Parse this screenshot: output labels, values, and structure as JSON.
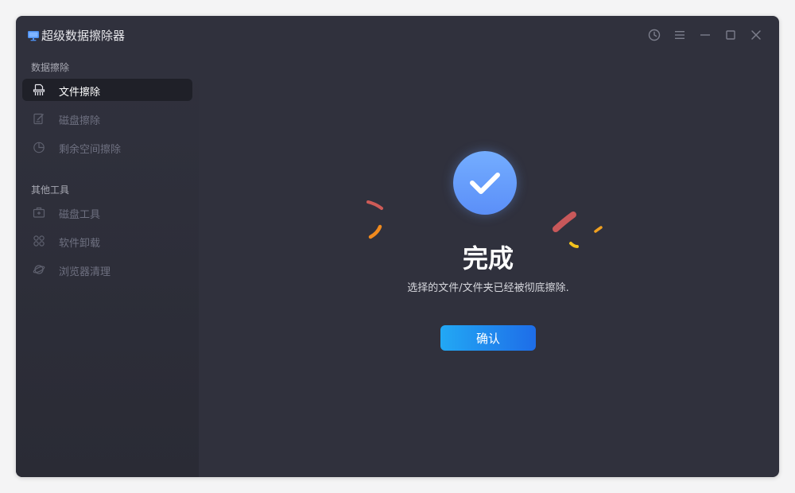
{
  "app": {
    "title": "超级数据擦除器",
    "logo_icon": "monitor-icon",
    "accent_color": "#5b8ff8"
  },
  "window_controls": [
    {
      "icon": "history-icon"
    },
    {
      "icon": "menu-icon"
    },
    {
      "icon": "minimize-icon"
    },
    {
      "icon": "maximize-icon"
    },
    {
      "icon": "close-icon"
    }
  ],
  "sidebar": {
    "sections": [
      {
        "title": "数据擦除",
        "items": [
          {
            "label": "文件擦除",
            "icon": "shredder-icon",
            "active": true
          },
          {
            "label": "磁盘擦除",
            "icon": "disk-erase-icon",
            "active": false
          },
          {
            "label": "剩余空间擦除",
            "icon": "pie-chart-icon",
            "active": false
          }
        ]
      },
      {
        "title": "其他工具",
        "items": [
          {
            "label": "磁盘工具",
            "icon": "toolbox-icon",
            "active": false
          },
          {
            "label": "软件卸载",
            "icon": "apps-grid-icon",
            "active": false
          },
          {
            "label": "浏览器清理",
            "icon": "planet-icon",
            "active": false
          }
        ]
      }
    ]
  },
  "result": {
    "icon": "check-circle-icon",
    "title": "完成",
    "message": "选择的文件/文件夹已经被彻底擦除.",
    "confirm_label": "确认"
  }
}
